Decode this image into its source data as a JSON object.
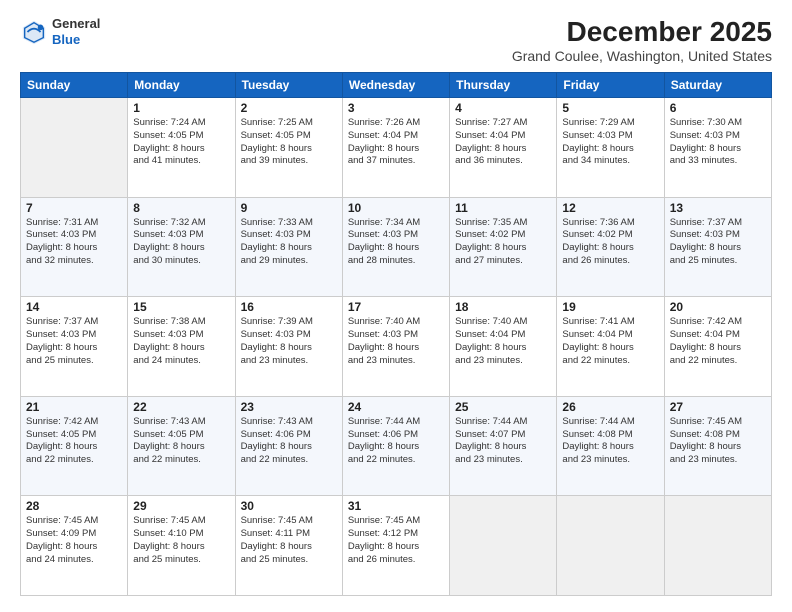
{
  "header": {
    "logo_line1": "General",
    "logo_line2": "Blue",
    "month_title": "December 2025",
    "location": "Grand Coulee, Washington, United States"
  },
  "days_of_week": [
    "Sunday",
    "Monday",
    "Tuesday",
    "Wednesday",
    "Thursday",
    "Friday",
    "Saturday"
  ],
  "weeks": [
    [
      {
        "day": "",
        "info": ""
      },
      {
        "day": "1",
        "info": "Sunrise: 7:24 AM\nSunset: 4:05 PM\nDaylight: 8 hours\nand 41 minutes."
      },
      {
        "day": "2",
        "info": "Sunrise: 7:25 AM\nSunset: 4:05 PM\nDaylight: 8 hours\nand 39 minutes."
      },
      {
        "day": "3",
        "info": "Sunrise: 7:26 AM\nSunset: 4:04 PM\nDaylight: 8 hours\nand 37 minutes."
      },
      {
        "day": "4",
        "info": "Sunrise: 7:27 AM\nSunset: 4:04 PM\nDaylight: 8 hours\nand 36 minutes."
      },
      {
        "day": "5",
        "info": "Sunrise: 7:29 AM\nSunset: 4:03 PM\nDaylight: 8 hours\nand 34 minutes."
      },
      {
        "day": "6",
        "info": "Sunrise: 7:30 AM\nSunset: 4:03 PM\nDaylight: 8 hours\nand 33 minutes."
      }
    ],
    [
      {
        "day": "7",
        "info": "Sunrise: 7:31 AM\nSunset: 4:03 PM\nDaylight: 8 hours\nand 32 minutes."
      },
      {
        "day": "8",
        "info": "Sunrise: 7:32 AM\nSunset: 4:03 PM\nDaylight: 8 hours\nand 30 minutes."
      },
      {
        "day": "9",
        "info": "Sunrise: 7:33 AM\nSunset: 4:03 PM\nDaylight: 8 hours\nand 29 minutes."
      },
      {
        "day": "10",
        "info": "Sunrise: 7:34 AM\nSunset: 4:03 PM\nDaylight: 8 hours\nand 28 minutes."
      },
      {
        "day": "11",
        "info": "Sunrise: 7:35 AM\nSunset: 4:02 PM\nDaylight: 8 hours\nand 27 minutes."
      },
      {
        "day": "12",
        "info": "Sunrise: 7:36 AM\nSunset: 4:02 PM\nDaylight: 8 hours\nand 26 minutes."
      },
      {
        "day": "13",
        "info": "Sunrise: 7:37 AM\nSunset: 4:03 PM\nDaylight: 8 hours\nand 25 minutes."
      }
    ],
    [
      {
        "day": "14",
        "info": "Sunrise: 7:37 AM\nSunset: 4:03 PM\nDaylight: 8 hours\nand 25 minutes."
      },
      {
        "day": "15",
        "info": "Sunrise: 7:38 AM\nSunset: 4:03 PM\nDaylight: 8 hours\nand 24 minutes."
      },
      {
        "day": "16",
        "info": "Sunrise: 7:39 AM\nSunset: 4:03 PM\nDaylight: 8 hours\nand 23 minutes."
      },
      {
        "day": "17",
        "info": "Sunrise: 7:40 AM\nSunset: 4:03 PM\nDaylight: 8 hours\nand 23 minutes."
      },
      {
        "day": "18",
        "info": "Sunrise: 7:40 AM\nSunset: 4:04 PM\nDaylight: 8 hours\nand 23 minutes."
      },
      {
        "day": "19",
        "info": "Sunrise: 7:41 AM\nSunset: 4:04 PM\nDaylight: 8 hours\nand 22 minutes."
      },
      {
        "day": "20",
        "info": "Sunrise: 7:42 AM\nSunset: 4:04 PM\nDaylight: 8 hours\nand 22 minutes."
      }
    ],
    [
      {
        "day": "21",
        "info": "Sunrise: 7:42 AM\nSunset: 4:05 PM\nDaylight: 8 hours\nand 22 minutes."
      },
      {
        "day": "22",
        "info": "Sunrise: 7:43 AM\nSunset: 4:05 PM\nDaylight: 8 hours\nand 22 minutes."
      },
      {
        "day": "23",
        "info": "Sunrise: 7:43 AM\nSunset: 4:06 PM\nDaylight: 8 hours\nand 22 minutes."
      },
      {
        "day": "24",
        "info": "Sunrise: 7:44 AM\nSunset: 4:06 PM\nDaylight: 8 hours\nand 22 minutes."
      },
      {
        "day": "25",
        "info": "Sunrise: 7:44 AM\nSunset: 4:07 PM\nDaylight: 8 hours\nand 23 minutes."
      },
      {
        "day": "26",
        "info": "Sunrise: 7:44 AM\nSunset: 4:08 PM\nDaylight: 8 hours\nand 23 minutes."
      },
      {
        "day": "27",
        "info": "Sunrise: 7:45 AM\nSunset: 4:08 PM\nDaylight: 8 hours\nand 23 minutes."
      }
    ],
    [
      {
        "day": "28",
        "info": "Sunrise: 7:45 AM\nSunset: 4:09 PM\nDaylight: 8 hours\nand 24 minutes."
      },
      {
        "day": "29",
        "info": "Sunrise: 7:45 AM\nSunset: 4:10 PM\nDaylight: 8 hours\nand 25 minutes."
      },
      {
        "day": "30",
        "info": "Sunrise: 7:45 AM\nSunset: 4:11 PM\nDaylight: 8 hours\nand 25 minutes."
      },
      {
        "day": "31",
        "info": "Sunrise: 7:45 AM\nSunset: 4:12 PM\nDaylight: 8 hours\nand 26 minutes."
      },
      {
        "day": "",
        "info": ""
      },
      {
        "day": "",
        "info": ""
      },
      {
        "day": "",
        "info": ""
      }
    ]
  ]
}
